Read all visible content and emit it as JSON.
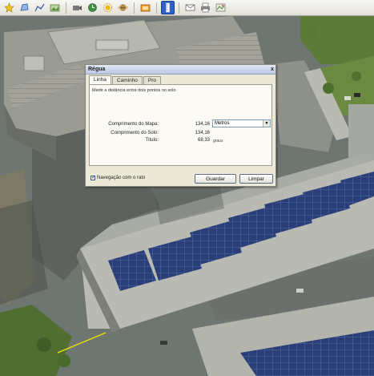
{
  "toolbar": {
    "buttons": [
      {
        "icon": "placemark-icon"
      },
      {
        "icon": "polygon-icon"
      },
      {
        "icon": "path-icon"
      },
      {
        "icon": "image-overlay-icon"
      },
      {
        "icon": "record-tour-icon"
      },
      {
        "icon": "historical-imagery-icon"
      },
      {
        "icon": "sun-icon"
      },
      {
        "icon": "planets-icon"
      },
      {
        "icon": "ruler-icon",
        "active": true
      },
      {
        "icon": "email-icon"
      },
      {
        "icon": "print-icon"
      },
      {
        "icon": "save-image-icon"
      },
      {
        "icon": "view-in-maps-icon"
      }
    ]
  },
  "dialog": {
    "title": "Régua",
    "close_label": "x",
    "tabs": [
      {
        "label": "Linha",
        "selected": true
      },
      {
        "label": "Caminho",
        "selected": false
      },
      {
        "label": "Pro",
        "selected": false
      }
    ],
    "description": "Medir a distância entre dois pontos no solo",
    "map_length_label": "Comprimento do Mapa:",
    "map_length_value": "134,16",
    "ground_length_label": "Comprimento do Solo:",
    "ground_length_value": "134,16",
    "heading_label": "Título:",
    "heading_value": "68,33",
    "heading_unit": "graus",
    "unit_select": "Metros",
    "navigation_checkbox_label": "Navegação com o rato",
    "navigation_checked": true,
    "save_button": "Guardar",
    "clear_button": "Limpar"
  },
  "colors": {
    "accent": "#2e62c9",
    "measure_line": "#f2e600"
  }
}
